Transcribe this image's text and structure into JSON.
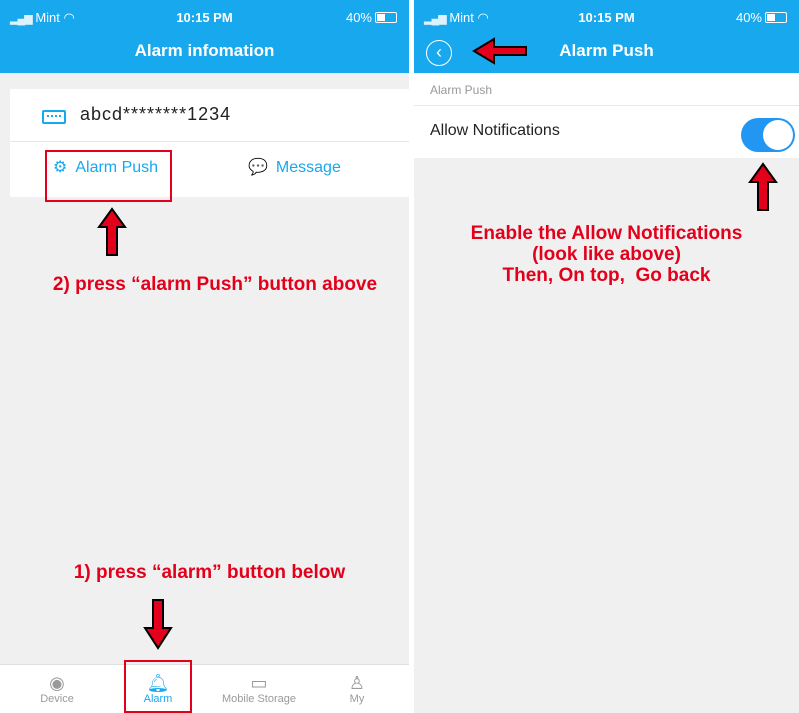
{
  "left_screen": {
    "status_bar": {
      "carrier": "Mint",
      "time": "10:15 PM",
      "battery": "40%"
    },
    "nav_title": "Alarm infomation",
    "device": {
      "name": "abcd********1234"
    },
    "tabs": [
      {
        "label": "Alarm Push",
        "icon": "gear-icon"
      },
      {
        "label": "Message",
        "icon": "chat-icon"
      }
    ],
    "bottom_nav": [
      {
        "label": "Device",
        "icon": "camera-icon"
      },
      {
        "label": "Alarm",
        "icon": "bell-icon",
        "active": true
      },
      {
        "label": "Mobile Storage",
        "icon": "tablet-icon"
      },
      {
        "label": "My",
        "icon": "person-icon"
      }
    ],
    "instructions": {
      "step2": "2) press “alarm Push” button above",
      "step1": "1) press “alarm” button below"
    }
  },
  "right_screen": {
    "status_bar": {
      "carrier": "Mint",
      "time": "10:15 PM",
      "battery": "40%"
    },
    "nav_title": "Alarm Push",
    "section_header": "Alarm Push",
    "setting": {
      "label": "Allow Notifications",
      "enabled": true
    },
    "instruction_lines": [
      "Enable the Allow Notifications",
      "(look like above)",
      "Then, On top,  Go back"
    ]
  },
  "colors": {
    "accent": "#17a8ee",
    "annotation": "#e3001b",
    "toggle_on": "#2196f3"
  }
}
